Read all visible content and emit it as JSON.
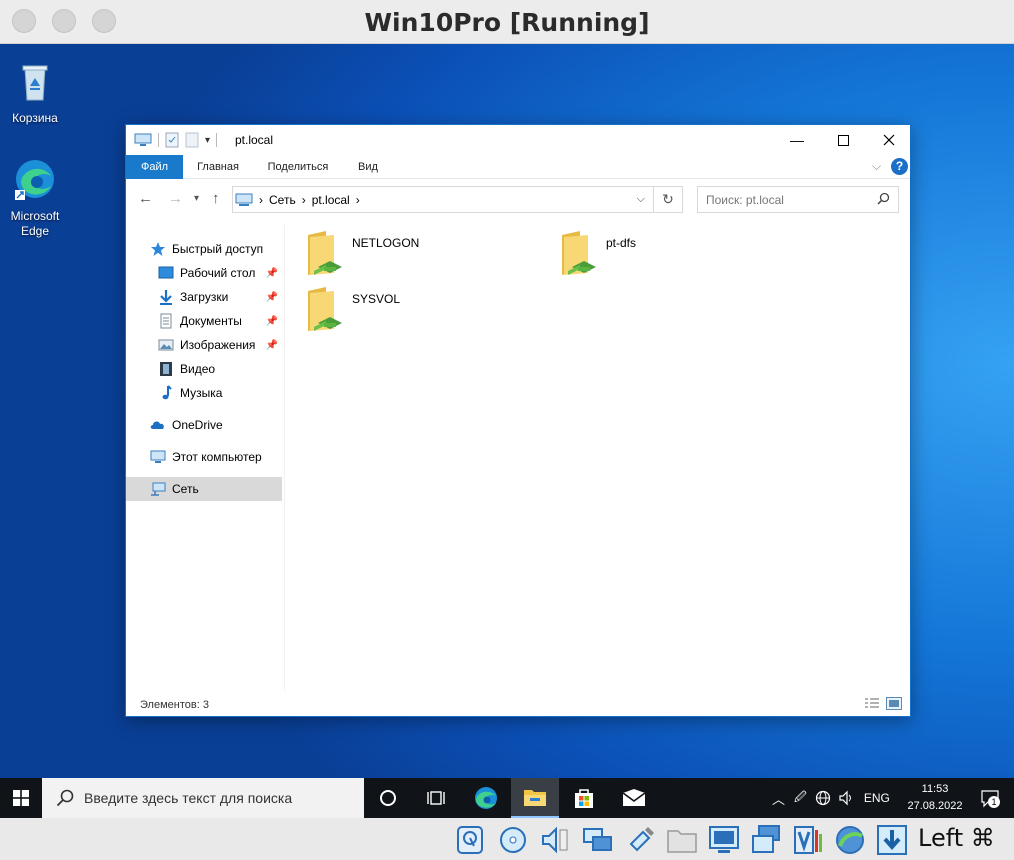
{
  "host": {
    "title": "Win10Pro [Running]",
    "host_key": "Left ⌘"
  },
  "desktop": {
    "icons": [
      {
        "label": "Корзина",
        "icon": "recycle-bin-icon"
      },
      {
        "label": "Microsoft Edge",
        "icon": "edge-icon"
      }
    ]
  },
  "explorer": {
    "title": "pt.local",
    "tabs": [
      "Файл",
      "Главная",
      "Поделиться",
      "Вид"
    ],
    "address": {
      "root": "Сеть",
      "current": "pt.local"
    },
    "search_placeholder": "Поиск: pt.local",
    "nav": {
      "quick_access": "Быстрый доступ",
      "quick_items": [
        "Рабочий стол",
        "Загрузки",
        "Документы",
        "Изображения",
        "Видео",
        "Музыка"
      ],
      "onedrive": "OneDrive",
      "this_pc": "Этот компьютер",
      "network": "Сеть"
    },
    "items": [
      "NETLOGON",
      "pt-dfs",
      "SYSVOL"
    ],
    "status": "Элементов: 3"
  },
  "taskbar": {
    "search_placeholder": "Введите здесь текст для поиска",
    "language": "ENG",
    "time": "11:53",
    "date": "27.08.2022",
    "notification_count": "1"
  },
  "colors": {
    "accent": "#1979ca",
    "nav_selected": "#d9d9d9",
    "taskbar": "#101418"
  }
}
